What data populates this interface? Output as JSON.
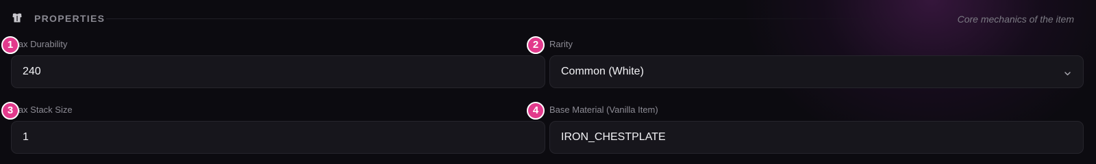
{
  "section": {
    "icon": "chestplate-icon",
    "title": "PROPERTIES",
    "subtitle": "Core mechanics of the item"
  },
  "fields": {
    "max_durability": {
      "label": "Max Durability",
      "value": "240"
    },
    "rarity": {
      "label": "Rarity",
      "value": "Common (White)",
      "icon": "chevron-down-icon"
    },
    "max_stack_size": {
      "label": "Max Stack Size",
      "value": "1"
    },
    "base_material": {
      "label": "Base Material (Vanilla Item)",
      "value": "IRON_CHESTPLATE"
    }
  },
  "badges": [
    "1",
    "2",
    "3",
    "4"
  ],
  "colors": {
    "background": "#0c0b10",
    "field_background": "#17161c",
    "field_border": "#26252c",
    "badge": "#e23a8c",
    "accent_glow": "#7a2a85"
  }
}
